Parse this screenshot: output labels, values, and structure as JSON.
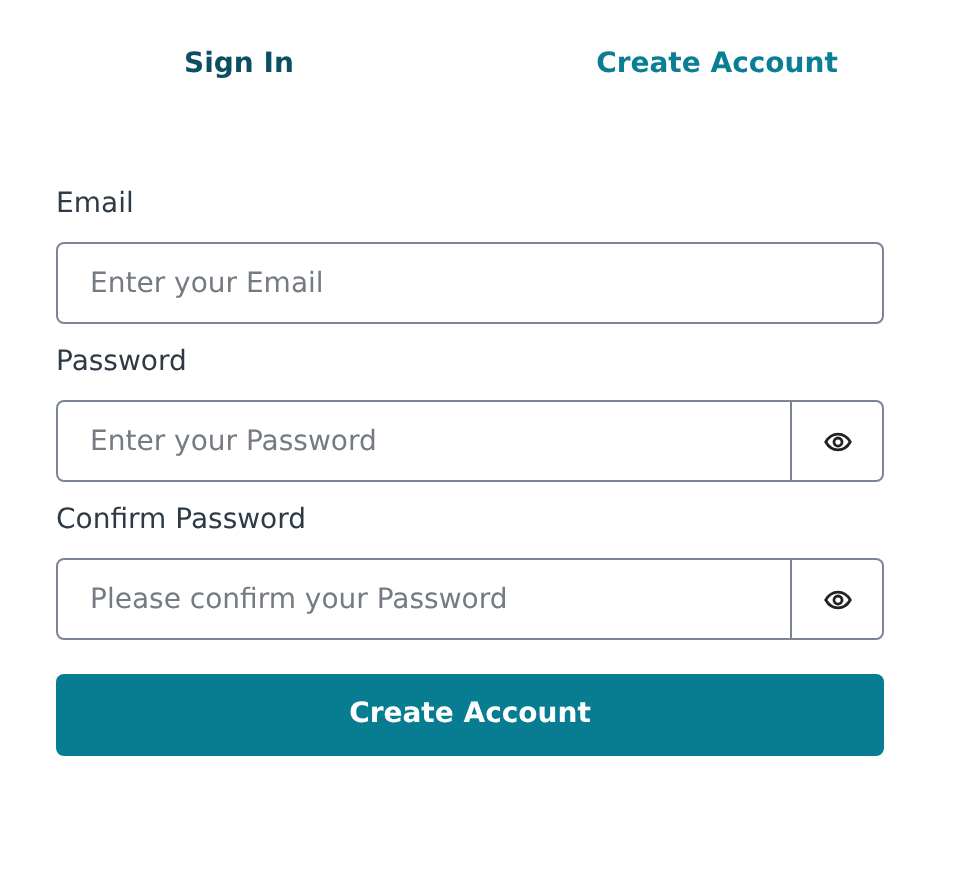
{
  "tabs": [
    {
      "label": "Sign In",
      "selected": false
    },
    {
      "label": "Create Account",
      "selected": true
    }
  ],
  "fields": [
    {
      "label": "Email",
      "placeholder": "Enter your Email",
      "kind": "text"
    },
    {
      "label": "Password",
      "placeholder": "Enter your Password",
      "kind": "password"
    },
    {
      "label": "Confirm Password",
      "placeholder": "Please confirm your Password",
      "kind": "password"
    }
  ],
  "submit": "Create Account"
}
